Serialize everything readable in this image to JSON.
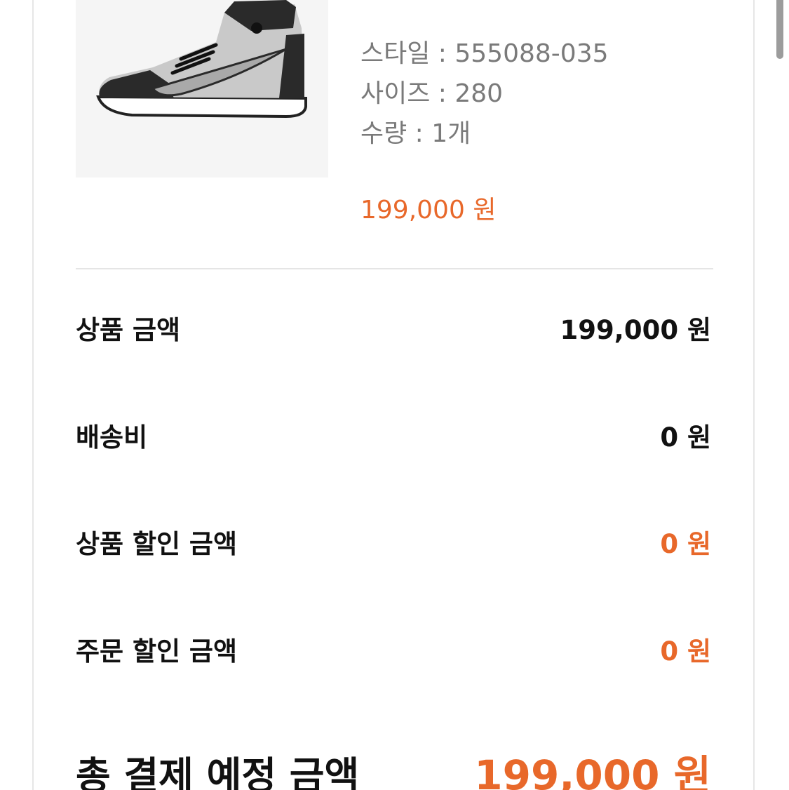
{
  "product": {
    "image": "air-jordan-1-high-sneaker",
    "style_line": "스타일 : 555088-035",
    "size_line": "사이즈 : 280",
    "qty_line": "수량 : 1개",
    "price": "199,000 원"
  },
  "summary": {
    "items": [
      {
        "label": "상품 금액",
        "value": "199,000 원"
      },
      {
        "label": "배송비",
        "value": "0 원"
      },
      {
        "label": "상품 할인 금액",
        "value": "0 원"
      },
      {
        "label": "주문 할인 금액",
        "value": "0 원"
      }
    ],
    "total": {
      "label": "총 결제 예정 금액",
      "value": "199,000 원"
    }
  },
  "colors": {
    "accent": "#e8682a",
    "text": "#111111",
    "muted": "#7a7a7a"
  }
}
